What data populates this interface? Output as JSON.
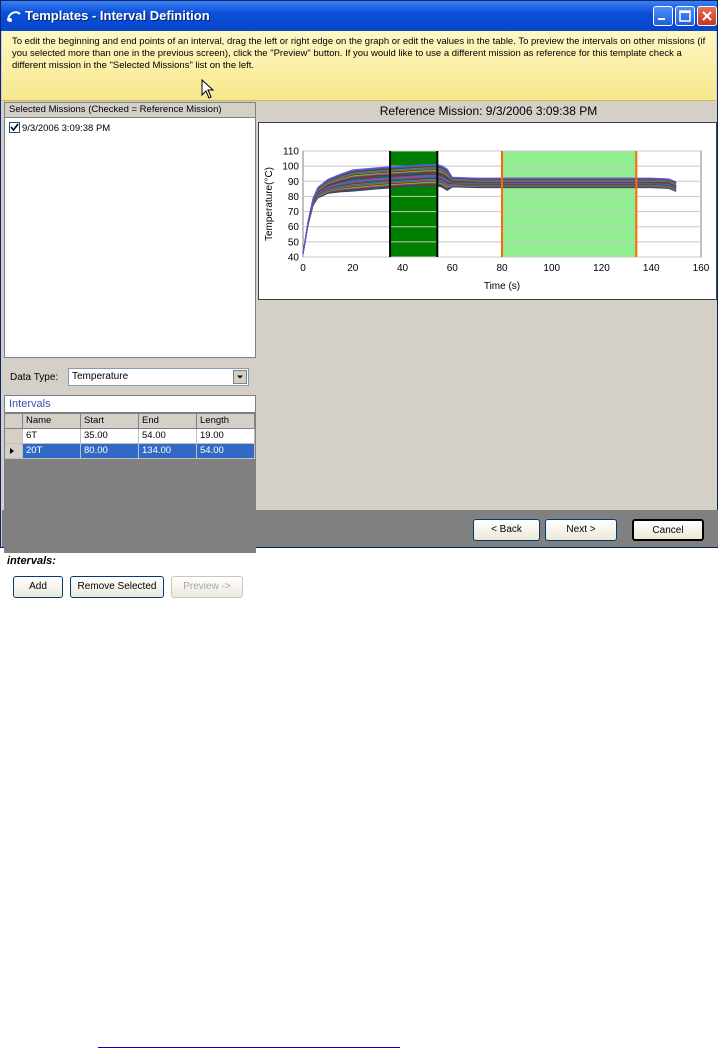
{
  "window": {
    "title": "Templates - Interval Definition",
    "colors": {
      "title_bar": "#0a4fd8",
      "info_bar": "#f6e88d",
      "selection": "#316ac5",
      "footer": "#808080"
    }
  },
  "info": {
    "text": "To edit the beginning and end points of an interval, drag the left or right edge on the graph or edit the values in the table.  To preview the intervals on other missions (if you selected more than one in the previous screen), click the \"Preview\" button.  If you would like to use a different mission as reference for this template check a different mission in the \"Selected Missions\" list on the left."
  },
  "missions": {
    "header": "Selected Missions (Checked = Reference Mission)",
    "items": [
      {
        "label": "9/3/2006 3:09:38 PM",
        "checked": true
      }
    ]
  },
  "data_type": {
    "label": "Data Type:",
    "value": "Temperature"
  },
  "intervals": {
    "header": "Intervals",
    "columns": [
      "Name",
      "Start",
      "End",
      "Length"
    ],
    "rows": [
      {
        "name": "6T",
        "start": "35.00",
        "end": "54.00",
        "length": "19.00",
        "selected": false
      },
      {
        "name": "20T",
        "start": "80.00",
        "end": "134.00",
        "length": "54.00",
        "selected": true
      }
    ],
    "section_label": "intervals:",
    "buttons": {
      "add": "Add",
      "remove": "Remove Selected",
      "preview": "Preview ->"
    }
  },
  "footer": {
    "back": "< Back",
    "next": "Next >",
    "cancel": "Cancel"
  },
  "chart_data": {
    "type": "line",
    "title": "Reference Mission: 9/3/2006 3:09:38 PM",
    "xlabel": "Time (s)",
    "ylabel": "Temperature(°C)",
    "xlim": [
      0,
      160
    ],
    "ylim": [
      40,
      110
    ],
    "x_ticks": [
      0,
      20,
      40,
      60,
      80,
      100,
      120,
      140,
      160
    ],
    "y_ticks": [
      40,
      50,
      60,
      70,
      80,
      90,
      100,
      110
    ],
    "grid": true,
    "intervals": [
      {
        "name": "6T",
        "start": 35,
        "end": 54,
        "color": "#008000"
      },
      {
        "name": "20T",
        "start": 80,
        "end": 134,
        "color": "#90ee90",
        "edge_color": "#ff6a00"
      }
    ],
    "series_count": 30,
    "series_shape": {
      "x": [
        0,
        2,
        4,
        6,
        10,
        15,
        20,
        30,
        40,
        50,
        54,
        56,
        58,
        60,
        70,
        80,
        100,
        120,
        140,
        147,
        150
      ],
      "base": [
        42,
        62,
        76,
        82,
        86,
        88,
        89.5,
        91,
        92,
        93,
        93,
        92,
        90,
        89,
        88.5,
        88.5,
        88.5,
        88.5,
        88.5,
        88,
        86
      ],
      "spread_low": -6,
      "spread_high": 8
    }
  }
}
